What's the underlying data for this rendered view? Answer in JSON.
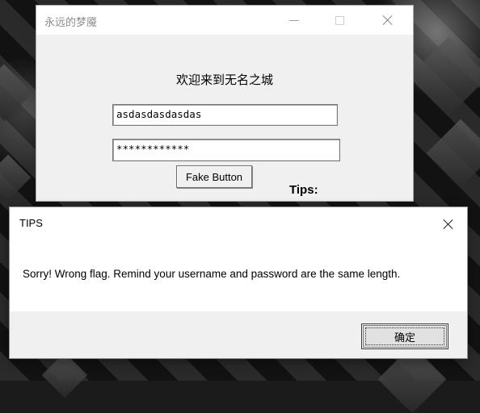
{
  "main_window": {
    "title": "永远的梦魇",
    "welcome_text": "欢迎来到无名之城",
    "username_value": "asdasdasdasdas",
    "password_value": "************",
    "fake_button_label": "Fake Button",
    "tips_label": "Tips:"
  },
  "message_box": {
    "title": "TIPS",
    "message": "Sorry! Wrong flag. Remind your username and password are the same length.",
    "ok_label": "确定"
  },
  "icons": {
    "minimize": "minimize-icon",
    "maximize": "maximize-icon",
    "close": "close-icon"
  }
}
